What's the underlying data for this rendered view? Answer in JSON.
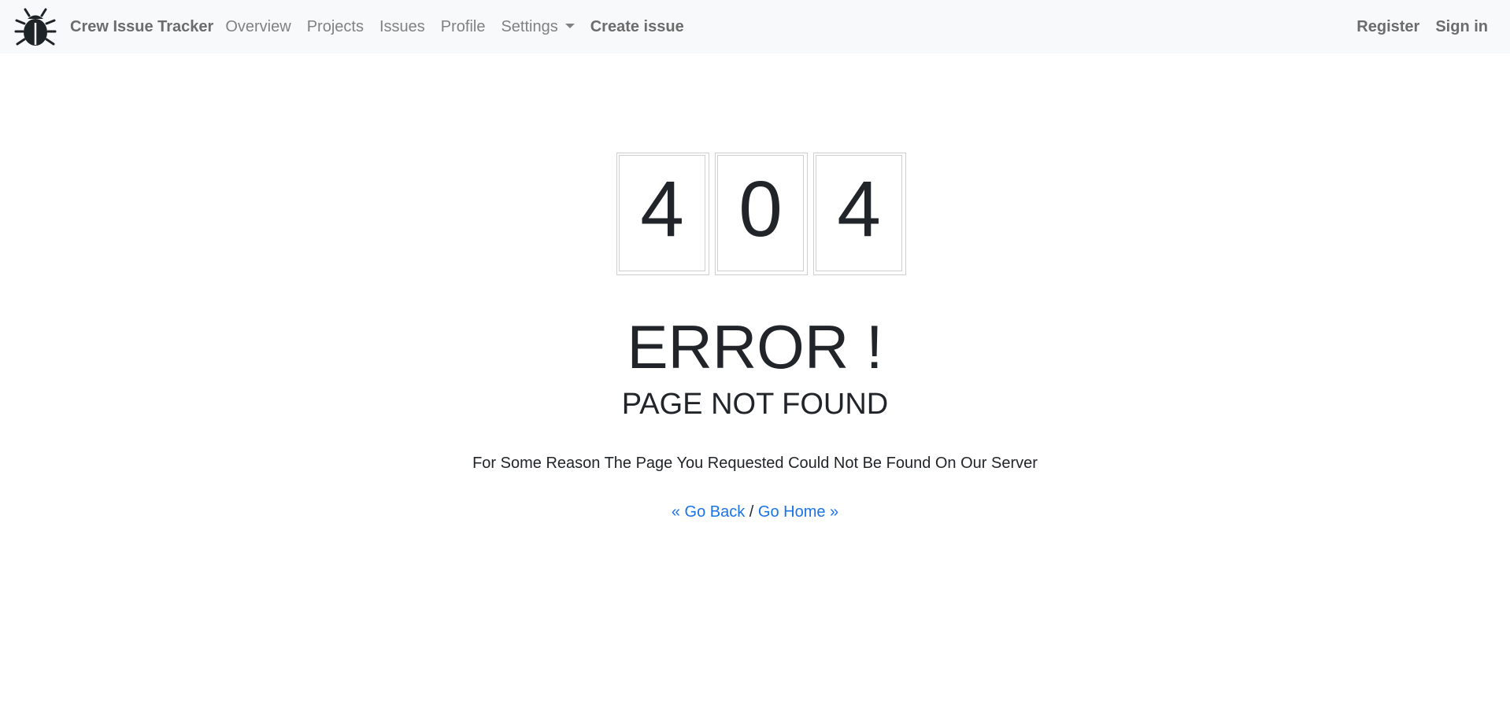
{
  "navbar": {
    "brand": "Crew Issue Tracker",
    "brand_icon": "bug-icon",
    "links": {
      "overview": "Overview",
      "projects": "Projects",
      "issues": "Issues",
      "profile": "Profile",
      "settings": "Settings",
      "create_issue": "Create issue"
    },
    "right": {
      "register": "Register",
      "sign_in": "Sign in"
    }
  },
  "error": {
    "digits": [
      "4",
      "0",
      "4"
    ],
    "title": "ERROR !",
    "subtitle": "PAGE NOT FOUND",
    "message": "For Some Reason The Page You Requested Could Not Be Found On Our Server",
    "go_back": "« Go Back",
    "separator": "/",
    "go_home": "Go Home »"
  },
  "colors": {
    "navbar_bg": "#f8f9fa",
    "link": "#1a73e8",
    "text": "#212529"
  }
}
